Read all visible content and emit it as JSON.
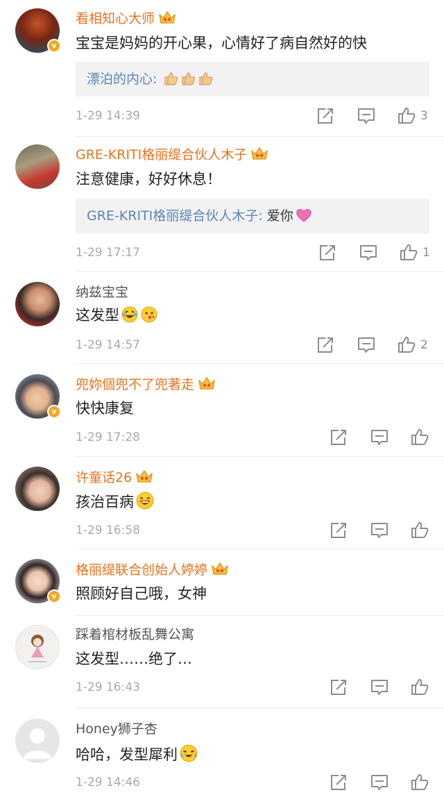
{
  "comments": [
    {
      "name": "看相知心大师",
      "text": "宝宝是妈妈的开心果，心情好了病自然好的快",
      "time": "1-29 14:39",
      "likes": "3",
      "reply": {
        "name": "漂泊的内心",
        "sep": ":",
        "text": ""
      }
    },
    {
      "name": "GRE-KRITI格丽缇合伙人木子",
      "text": "注意健康，好好休息！",
      "time": "1-29 17:17",
      "likes": "1",
      "reply": {
        "name": "GRE-KRITI格丽缇合伙人木子",
        "sep": ":",
        "text": "爱你"
      }
    },
    {
      "name": "纳兹宝宝",
      "text": "这发型",
      "time": "1-29 14:57",
      "likes": "2"
    },
    {
      "name": "兜妳個兜不了兜著走",
      "text": "快快康复",
      "time": "1-29 17:28",
      "likes": ""
    },
    {
      "name": "许童话26",
      "text": "孩治百病",
      "time": "1-29 16:58",
      "likes": ""
    },
    {
      "name": "格丽缇联合创始人婷婷",
      "text": "照顾好自己哦，女神",
      "time": "",
      "likes": ""
    },
    {
      "name": "踩着棺材板乱舞公寓",
      "text": "这发型……绝了…",
      "time": "1-29 16:43",
      "likes": ""
    },
    {
      "name": "Honey狮子杏",
      "text": "哈哈，发型犀利",
      "time": "1-29 14:46",
      "likes": ""
    }
  ],
  "icons": {
    "repost": "repost-icon",
    "comment": "comment-icon",
    "like": "like-icon",
    "crown": "vip-crown-icon",
    "verified": "verified-badge-icon"
  },
  "colors": {
    "vip_name": "#e8731e",
    "reply_name": "#5b84b6",
    "time": "#a9a9a9",
    "reply_bg": "#f2f2f2",
    "badge": "#f5a623"
  }
}
